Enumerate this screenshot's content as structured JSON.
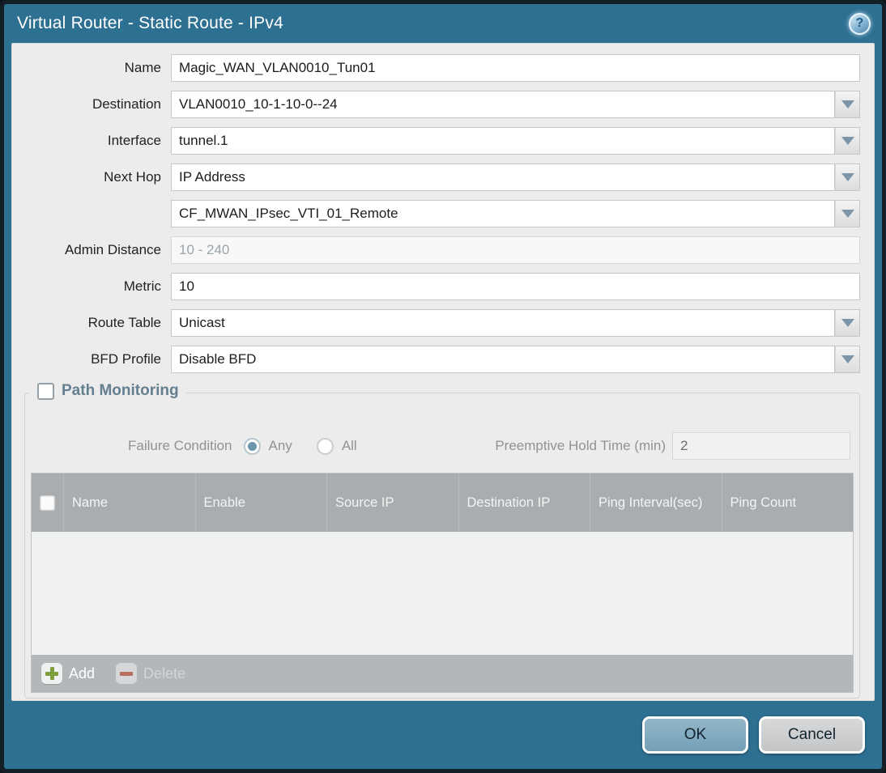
{
  "dialog": {
    "title": "Virtual Router - Static Route - IPv4",
    "help_icon": "?"
  },
  "fields": {
    "name": {
      "label": "Name",
      "value": "Magic_WAN_VLAN0010_Tun01"
    },
    "destination": {
      "label": "Destination",
      "value": "VLAN0010_10-1-10-0--24"
    },
    "interface": {
      "label": "Interface",
      "value": "tunnel.1"
    },
    "next_hop": {
      "label": "Next Hop",
      "value": "IP Address"
    },
    "next_hop_address": {
      "value": "CF_MWAN_IPsec_VTI_01_Remote"
    },
    "admin_distance": {
      "label": "Admin Distance",
      "placeholder": "10 - 240",
      "value": ""
    },
    "metric": {
      "label": "Metric",
      "value": "10"
    },
    "route_table": {
      "label": "Route Table",
      "value": "Unicast"
    },
    "bfd_profile": {
      "label": "BFD Profile",
      "value": "Disable BFD"
    }
  },
  "path_monitoring": {
    "legend": "Path Monitoring",
    "enabled": false,
    "failure_condition_label": "Failure Condition",
    "option_any": "Any",
    "option_all": "All",
    "selected_option": "Any",
    "preemptive_label": "Preemptive Hold Time (min)",
    "preemptive_value": "2",
    "table": {
      "headers": [
        "Name",
        "Enable",
        "Source IP",
        "Destination IP",
        "Ping Interval(sec)",
        "Ping Count"
      ],
      "rows": []
    },
    "add_label": "Add",
    "delete_label": "Delete"
  },
  "footer": {
    "ok_label": "OK",
    "cancel_label": "Cancel"
  },
  "colors": {
    "titlebar": "#2e7091",
    "content_bg": "#ececec",
    "table_header": "#a9adaf",
    "ok_button": "#7fa9bf",
    "add_icon_green": "#7f9c3f",
    "delete_icon_red": "#b5705f"
  }
}
